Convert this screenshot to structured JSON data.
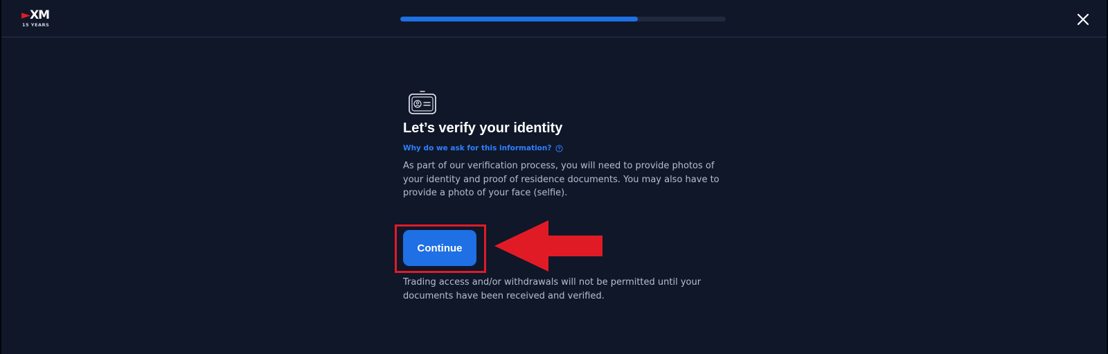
{
  "header": {
    "logo_text": "XM",
    "logo_sub": "15 YEARS",
    "progress_fraction": 0.73,
    "accent_color": "#1f6fe5"
  },
  "icons": {
    "close": "close-icon",
    "id_card": "id-card-icon",
    "help": "question-circle-icon",
    "annotation_arrow": "left-arrow-annotation"
  },
  "main": {
    "title": "Let’s verify your identity",
    "why_link": "Why do we ask for this information?",
    "description": "As part of our verification process, you will need to provide photos of your identity and proof of residence documents. You may also have to provide a photo of your face (selfie).",
    "continue_label": "Continue",
    "note": "Trading access and/or withdrawals will not be permitted until your documents have been received and verified."
  },
  "annotation": {
    "highlight_color": "#e11b26"
  }
}
